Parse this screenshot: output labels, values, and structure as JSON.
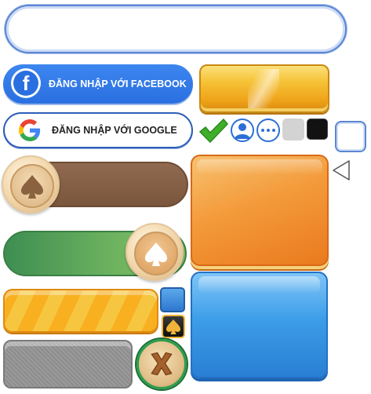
{
  "login": {
    "facebook_label": "ĐĂNG NHẬP VỚI FACEBOOK",
    "google_label": "ĐĂNG NHẬP VỚI GOOGLE",
    "facebook_icon": "facebook-f-icon",
    "google_icon": "google-g-icon"
  },
  "icons": {
    "check": "checkmark-icon",
    "user": "user-avatar-icon",
    "more": "more-dots-icon",
    "arrow": "arrow-left-icon",
    "spade": "spade-icon",
    "close": "close-x-icon"
  },
  "colors": {
    "facebook_blue": "#2a6fe0",
    "gold": "#f6c237",
    "orange": "#f39a3a",
    "blue": "#3c9de8",
    "green": "#3e8e52",
    "brown": "#7a563c",
    "check_green": "#3fae2a",
    "swatch_gray": "#d3d3d3",
    "swatch_black": "#121212"
  }
}
